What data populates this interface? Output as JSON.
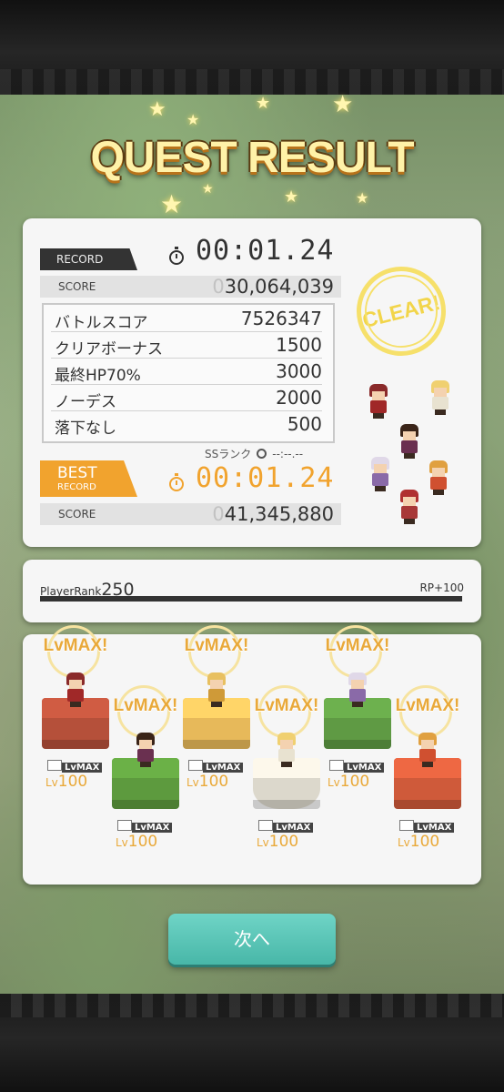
{
  "screen_title": "QUEST RESULT",
  "result": {
    "record_label": "RECORD",
    "record_time": "00:01.24",
    "score_label": "SCORE",
    "score_leading": "0",
    "score_value": "30,064,039",
    "bonuses": [
      {
        "label": "バトルスコア",
        "value": "7526347"
      },
      {
        "label": "クリアボーナス",
        "value": "1500"
      },
      {
        "label": "最終HP70%",
        "value": "3000"
      },
      {
        "label": "ノーデス",
        "value": "2000"
      },
      {
        "label": "落下なし",
        "value": "500"
      }
    ],
    "clear_stamp": "CLEAR!",
    "ss_rank_label": "SSランク",
    "ss_rank_time": "--:--.--",
    "best_label_top": "BEST",
    "best_label_bottom": "RECORD",
    "best_time": "00:01.24",
    "best_score_label": "SCORE",
    "best_score_leading": "0",
    "best_score_value": "41,345,880"
  },
  "player": {
    "rank_label": "PlayerRank",
    "rank_value": "250",
    "rp_gain": "RP+100",
    "rank_progress": 1.0
  },
  "units": [
    {
      "lvmax": "LvMAX!",
      "badge": "LvMAX",
      "lv_prefix": "Lv",
      "lv": "100",
      "block_color": "#b5503a",
      "hair": "#8a2a2a",
      "body": "#a02828"
    },
    {
      "lvmax": "LvMAX!",
      "badge": "LvMAX",
      "lv_prefix": "Lv",
      "lv": "100",
      "block_color": "#5d9a3e",
      "hair": "#3a2418",
      "body": "#6a3050"
    },
    {
      "lvmax": "LvMAX!",
      "badge": "LvMAX",
      "lv_prefix": "Lv",
      "lv": "100",
      "block_color": "#e7b95a",
      "hair": "#e8c060",
      "body": "#cf9a38"
    },
    {
      "lvmax": "LvMAX!",
      "badge": "LvMAX",
      "lv_prefix": "Lv",
      "lv": "100",
      "block_color": "#dcd8cc",
      "hair": "#f0d070",
      "body": "#e8e2d0"
    },
    {
      "lvmax": "LvMAX!",
      "badge": "LvMAX",
      "lv_prefix": "Lv",
      "lv": "100",
      "block_color": "#5f9a44",
      "hair": "#e0d8e8",
      "body": "#8a6aa8"
    },
    {
      "lvmax": "LvMAX!",
      "badge": "LvMAX",
      "lv_prefix": "Lv",
      "lv": "100",
      "block_color": "#cf5a3a",
      "hair": "#e0a040",
      "body": "#d05030"
    }
  ],
  "next_button": "次へ"
}
